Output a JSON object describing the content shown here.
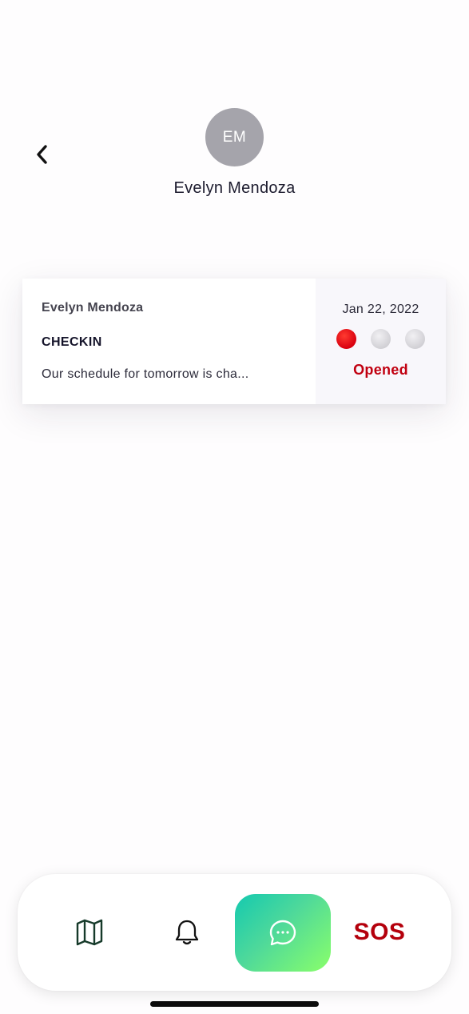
{
  "header": {
    "back_icon": "chevron-left-icon",
    "avatar_initials": "EM",
    "contact_name": "Evelyn Mendoza"
  },
  "message": {
    "sender": "Evelyn Mendoza",
    "title": "CHECKIN",
    "preview": "Our schedule for tomorrow is cha...",
    "date": "Jan 22, 2022",
    "status": "Opened",
    "status_color": "#c10010",
    "progress_dots": 3,
    "progress_active": 1
  },
  "nav": {
    "map_icon": "map-icon",
    "bell_icon": "bell-icon",
    "chat_icon": "chat-bubble-icon",
    "sos_label": "SOS",
    "active_gradient": [
      "#14c9b0",
      "#8aff6a"
    ]
  }
}
